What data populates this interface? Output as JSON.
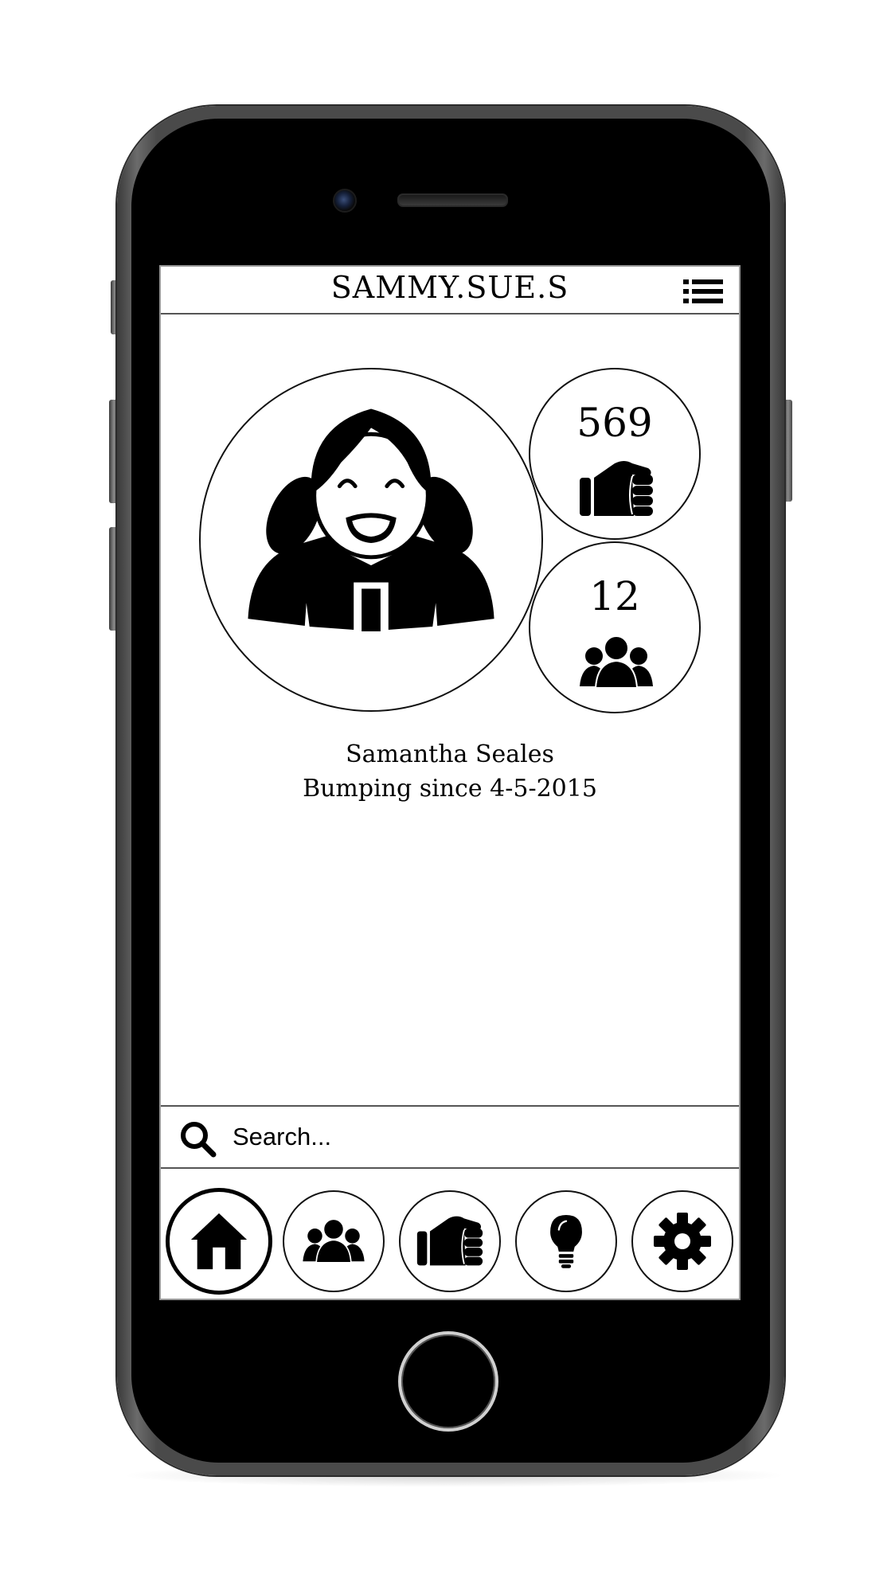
{
  "header": {
    "username": "SAMMY.SUE.S",
    "menu_icon": "list-menu-icon"
  },
  "profile": {
    "name": "Samantha Seales",
    "since": "Bumping since 4-5-2015",
    "avatar_icon": "girl-avatar-icon"
  },
  "stats": {
    "bumps": {
      "value": "569",
      "icon": "fist-bump-icon"
    },
    "friends": {
      "value": "12",
      "icon": "group-people-icon"
    }
  },
  "search": {
    "placeholder": "Search...",
    "icon": "search-icon"
  },
  "nav": {
    "items": [
      {
        "icon": "home-icon",
        "active": true
      },
      {
        "icon": "group-people-icon",
        "active": false
      },
      {
        "icon": "fist-bump-icon",
        "active": false
      },
      {
        "icon": "lightbulb-icon",
        "active": false
      },
      {
        "icon": "gear-icon",
        "active": false
      }
    ]
  }
}
